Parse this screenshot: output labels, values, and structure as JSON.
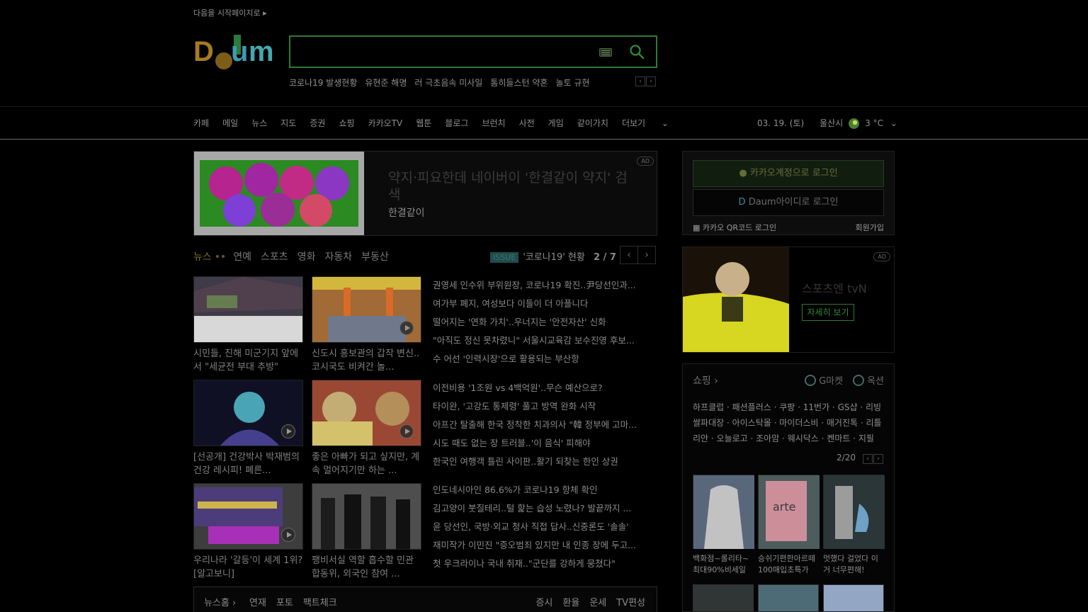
{
  "header": {
    "start_page": "다음을 시작페이지로",
    "trending": [
      "코로나19 발생현황",
      "유현준 해명",
      "러 극초음속 미사일",
      "톰히들스턴 약혼",
      "놀토 규현"
    ]
  },
  "nav": {
    "items": [
      "카페",
      "메일",
      "뉴스",
      "지도",
      "증권",
      "쇼핑",
      "카카오TV",
      "웹툰",
      "블로그",
      "브런치",
      "사전",
      "게임",
      "같이가치",
      "더보기"
    ],
    "date": "03. 19. (토)",
    "location": "울산시",
    "temperature": "3 °C"
  },
  "ad_banner": {
    "title": "약지·피요한데 네이버이 '한결같이 약지' 검색",
    "advertiser": "한결같이",
    "badge": "AD"
  },
  "news_tabs": {
    "items": [
      "뉴스",
      "연예",
      "스포츠",
      "영화",
      "자동차",
      "부동산"
    ],
    "issue_badge": "ISSUE",
    "issue_text": "'코로나19' 현황",
    "page": "2 / 7"
  },
  "news": {
    "thumbs": [
      {
        "caption": "시민들, 진해 미군기지 앞에서 \"세균전 부대 추방\""
      },
      {
        "caption": "신도시 흥보관의 갑작 변신..코시국도 비켜간 놀..."
      },
      {
        "caption": "[선공개] 건강박사 박재범의 건강 레시피! 폐른..."
      },
      {
        "caption": "좋은 아빠가 되고 싶지만, 계속 멀어지기만 하는 ..."
      },
      {
        "caption": "우리나라 '갈등'이 세계 1위?[알고보니]"
      },
      {
        "caption": "팽비서실 역할 흡수할 민관합동위, 외국인 참여 ..."
      }
    ],
    "headline_groups": [
      [
        "권영세 인수위 부위원장, 코로나19 확진..尹당선인과...",
        "여가부 폐지, 여성보다 이들이 더 아플니다",
        "떨어지는 '연화 가치'..우너지는 '안전자산' 신화",
        "\"아직도 정신 못차렸니\" 서울시교육감 보수진영 후보...",
        "수 어선 '인력시장'으로 활용되는 부산항"
      ],
      [
        "이전비용 '1조원 vs 4백억원'..무슨 예산으로?",
        "타이완, '고강도 통제령' 풀고 방역 완화 시작",
        "아프간 탈출해 한국 정착한 치과의사 \"韓 정부에 고마...",
        "시도 때도 없는 장 트러블..'이 음식' 피해야",
        "한국인 여행객 틀린 사이판..활기 되찾는 한인 상권"
      ],
      [
        "인도네시아인 86.6%가 코로나19 항체 확인",
        "김고양이 붓질테리..털 핥는 습성 노렸나? 발끝까지 ...",
        "윤 당선인, 국방·외교 청사 직접 답사..신중론도 '솔솔'",
        "재미작가 이민진 \"증오범죄 있지만 내 인종 장에 두고...",
        "첫 우크라이나 국내 취재..\"군단를 강하게 뭉쳤다\""
      ]
    ],
    "bottom_bar": {
      "home": "뉴스홈",
      "links_left": [
        "연재",
        "포토",
        "팩트체크"
      ],
      "links_right": [
        "증시",
        "환율",
        "운세",
        "TV편성"
      ]
    }
  },
  "login": {
    "kakao": "카카오계정으로 로그인",
    "daum": "Daum아이디로 로그인",
    "qr": "카카오 QR코드 로그인",
    "signup": "회원가입"
  },
  "sports_ad": {
    "badge": "AD",
    "title": "스포츠엔 tvN",
    "button": "자세히 보기"
  },
  "shopping": {
    "title": "쇼핑",
    "gmarket": "G마켓",
    "auction": "옥션",
    "links": "하프클럽 · 패션플러스 · 쿠팡 · 11번가 · GS샵 · 리빙쌀파대장 · 아이스탁몰 · 마이더스비 · 매거진톡 · 리틀리안 · 오늘로고 · 조아맘 · 웨시닥스 · 켄마트 · 지필",
    "page": "2/20",
    "products": [
      {
        "caption": "백화점~롤리타~최대90%비세일"
      },
      {
        "caption": "승쉬기편한아르떼 100매입초특가"
      },
      {
        "caption": "멋했다 걸었다 이거 너무편해!"
      }
    ]
  },
  "colors": {
    "brand_green": "#2f7a35",
    "logo_gold": "#a67b22",
    "logo_teal": "#4aa9b5"
  }
}
